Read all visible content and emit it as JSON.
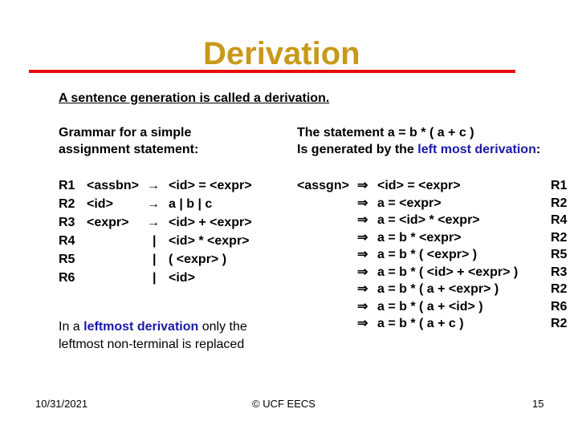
{
  "slide": {
    "title": "Derivation",
    "subtitle": "A sentence generation is called a derivation.",
    "left_heading": [
      "Grammar for a simple",
      "assignment statement:"
    ],
    "right_heading": {
      "line1": "The statement a = b * ( a + c )",
      "line2_prefix": "Is generated by the ",
      "line2_highlight": "left most derivation",
      "line2_suffix": ":"
    },
    "grammar_rules": [
      {
        "rule": "R1",
        "lhs": "<assbn>",
        "sep": "→",
        "rhs": "<id> = <expr>"
      },
      {
        "rule": "R2",
        "lhs": "<id>",
        "sep": "→",
        "rhs": "a | b | c"
      },
      {
        "rule": "R3",
        "lhs": "<expr>",
        "sep": "→",
        "rhs": "<id> + <expr>"
      },
      {
        "rule": "R4",
        "lhs": "",
        "sep": "|",
        "rhs": "<id> * <expr>"
      },
      {
        "rule": "R5",
        "lhs": "",
        "sep": "|",
        "rhs": "( <expr> )"
      },
      {
        "rule": "R6",
        "lhs": "",
        "sep": "|",
        "rhs": "<id>"
      }
    ],
    "derivation_start": "<assgn>",
    "derivation_steps": [
      {
        "arrow": "⇒",
        "expr": "<id> = <expr>",
        "rule": "R1"
      },
      {
        "arrow": "⇒",
        "expr": "a = <expr>",
        "rule": "R2"
      },
      {
        "arrow": "⇒",
        "expr": "a = <id> * <expr>",
        "rule": "R4"
      },
      {
        "arrow": "⇒",
        "expr": "a = b * <expr>",
        "rule": "R2"
      },
      {
        "arrow": "⇒",
        "expr": "a = b * ( <expr> )",
        "rule": "R5"
      },
      {
        "arrow": "⇒",
        "expr": "a = b * ( <id> + <expr> )",
        "rule": "R3"
      },
      {
        "arrow": "⇒",
        "expr": "a = b * ( a + <expr> )",
        "rule": "R2"
      },
      {
        "arrow": "⇒",
        "expr": "a = b * ( a + <id> )",
        "rule": "R6"
      },
      {
        "arrow": "⇒",
        "expr": "a = b * ( a + c )",
        "rule": "R2"
      }
    ],
    "note": {
      "prefix": "In a ",
      "highlight": "leftmost derivation",
      "suffix": " only the",
      "line2": "leftmost non-terminal is replaced"
    },
    "footer": {
      "date": "10/31/2021",
      "copyright": "© UCF EECS",
      "page": "15"
    }
  },
  "colors": {
    "title": "#c8991a",
    "rule": "#e60a0a",
    "highlight": "#1a1aa8"
  }
}
